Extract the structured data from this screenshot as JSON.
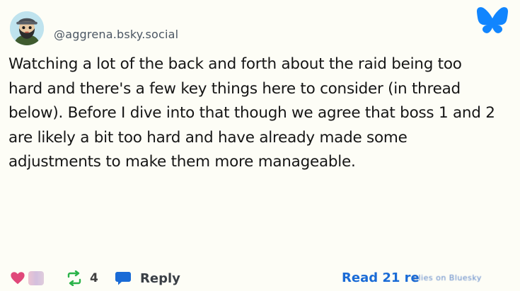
{
  "author": {
    "handle": "@aggrena.bsky.social",
    "avatar_icon": "bearded-man-avatar"
  },
  "app": {
    "logo_icon": "bluesky-butterfly-icon",
    "brand_color": "#1185fe"
  },
  "post": {
    "lines": [
      "Watching a lot of the back and forth about the raid being too",
      "hard and there's a few key things here to consider (in thread",
      "below). Before I dive into that though we agree that boss 1 and 2",
      "are likely a bit too hard and have already made some",
      "adjustments to make them more manageable."
    ]
  },
  "actions": {
    "like_icon": "heart-icon",
    "like_color": "#e0487a",
    "repost_icon": "repost-icon",
    "repost_count": "4",
    "repost_color": "#2bb34a",
    "reply_icon": "speech-bubble-icon",
    "reply_label": "Reply",
    "reply_color": "#1a6bd6"
  },
  "read_more": {
    "label": "Read 21 re",
    "tail": "plies on Bluesky"
  }
}
